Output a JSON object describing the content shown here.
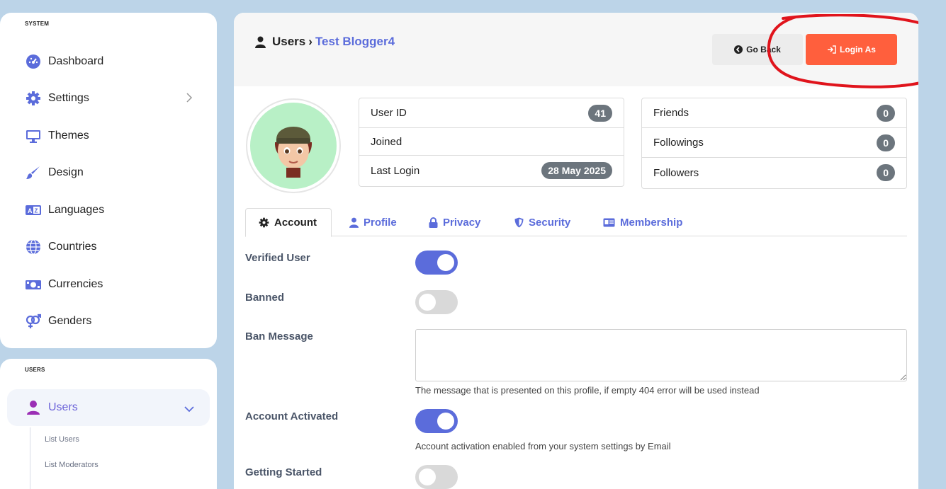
{
  "sidebar": {
    "system_label": "SYSTEM",
    "items": [
      {
        "label": "Dashboard"
      },
      {
        "label": "Settings"
      },
      {
        "label": "Themes"
      },
      {
        "label": "Design"
      },
      {
        "label": "Languages"
      },
      {
        "label": "Countries"
      },
      {
        "label": "Currencies"
      },
      {
        "label": "Genders"
      }
    ],
    "users_label": "USERS",
    "users_item": "Users",
    "sub_items": [
      "List Users",
      "List Moderators"
    ]
  },
  "header": {
    "crumb_root": "Users",
    "crumb_sep": "›",
    "crumb_current": "Test Blogger4",
    "go_back": "Go Back",
    "login_as": "Login As"
  },
  "stats_left": [
    {
      "label": "User ID",
      "value": "41"
    },
    {
      "label": "Joined",
      "value": ""
    },
    {
      "label": "Last Login",
      "value": "28 May 2025"
    }
  ],
  "stats_right": [
    {
      "label": "Friends",
      "value": "0"
    },
    {
      "label": "Followings",
      "value": "0"
    },
    {
      "label": "Followers",
      "value": "0"
    }
  ],
  "tabs": [
    "Account",
    "Profile",
    "Privacy",
    "Security",
    "Membership"
  ],
  "form": {
    "verified_label": "Verified User",
    "verified_on": true,
    "banned_label": "Banned",
    "banned_on": false,
    "ban_message_label": "Ban Message",
    "ban_message_value": "",
    "ban_message_help": "The message that is presented on this profile, if empty 404 error will be used instead",
    "activated_label": "Account Activated",
    "activated_on": true,
    "activated_help": "Account activation enabled from your system settings by Email",
    "getting_started_label": "Getting Started",
    "getting_started_on": false
  },
  "colors": {
    "accent": "#5b6cdb",
    "login_button": "#ff5f3d",
    "annotation": "#e0141c",
    "background": "#bcd4e8"
  },
  "icons": {
    "dashboard": "gauge-icon",
    "settings": "gear-icon",
    "themes": "monitor-icon",
    "design": "brush-icon",
    "languages": "translate-icon",
    "countries": "globe-icon",
    "currencies": "money-icon",
    "genders": "gender-icon"
  }
}
